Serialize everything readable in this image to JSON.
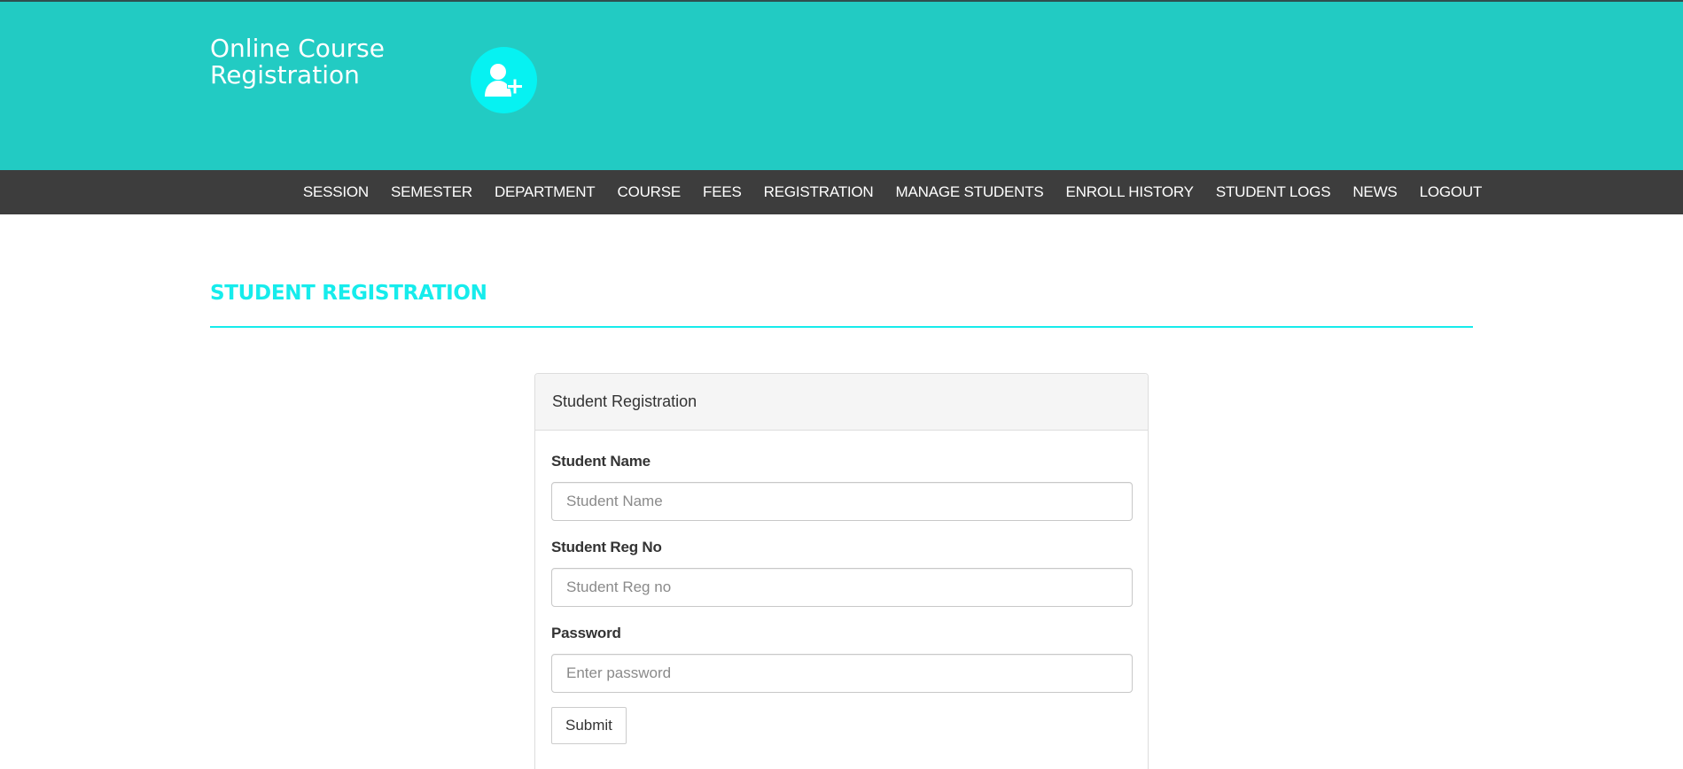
{
  "header": {
    "brand_title": "Online Course Registration",
    "logo_icon": "user-plus-icon",
    "accent_color": "#22cbc3"
  },
  "nav": {
    "items": [
      {
        "label": "SESSION"
      },
      {
        "label": "SEMESTER"
      },
      {
        "label": "DEPARTMENT"
      },
      {
        "label": "COURSE"
      },
      {
        "label": "FEES"
      },
      {
        "label": "REGISTRATION"
      },
      {
        "label": "MANAGE STUDENTS"
      },
      {
        "label": "ENROLL HISTORY"
      },
      {
        "label": "STUDENT LOGS"
      },
      {
        "label": "NEWS"
      },
      {
        "label": "LOGOUT"
      }
    ]
  },
  "main": {
    "page_title": "STUDENT REGISTRATION",
    "title_color": "#16ecec"
  },
  "form": {
    "panel_heading": "Student Registration",
    "fields": [
      {
        "label": "Student Name",
        "placeholder": "Student Name",
        "value": ""
      },
      {
        "label": "Student Reg No",
        "placeholder": "Student Reg no",
        "value": ""
      },
      {
        "label": "Password",
        "placeholder": "Enter password",
        "value": ""
      }
    ],
    "submit_label": "Submit"
  }
}
